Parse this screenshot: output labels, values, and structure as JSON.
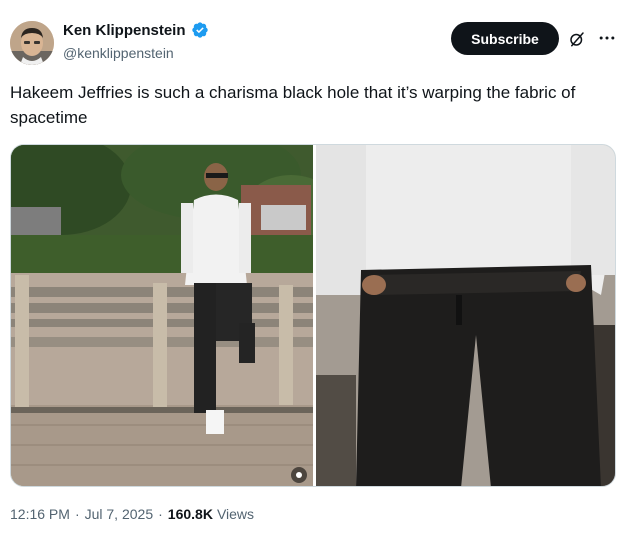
{
  "author": {
    "name": "Ken Klippenstein",
    "handle": "@kenklippenstein",
    "verified": true
  },
  "actions": {
    "subscribe_label": "Subscribe"
  },
  "tweet": {
    "text": "Hakeem Jeffries is such a charisma black hole that it’s warping the fabric of spacetime"
  },
  "meta": {
    "time": "12:16 PM",
    "separator": "·",
    "date": "Jul 7, 2025",
    "views_count": "160.8K",
    "views_label": "Views"
  },
  "icons": {
    "verified": "verified-badge-icon",
    "grok": "grok-icon",
    "more": "more-icon"
  },
  "colors": {
    "verified_blue": "#1d9bf0",
    "subscribe_bg": "#0f1419",
    "secondary_text": "#536471"
  }
}
